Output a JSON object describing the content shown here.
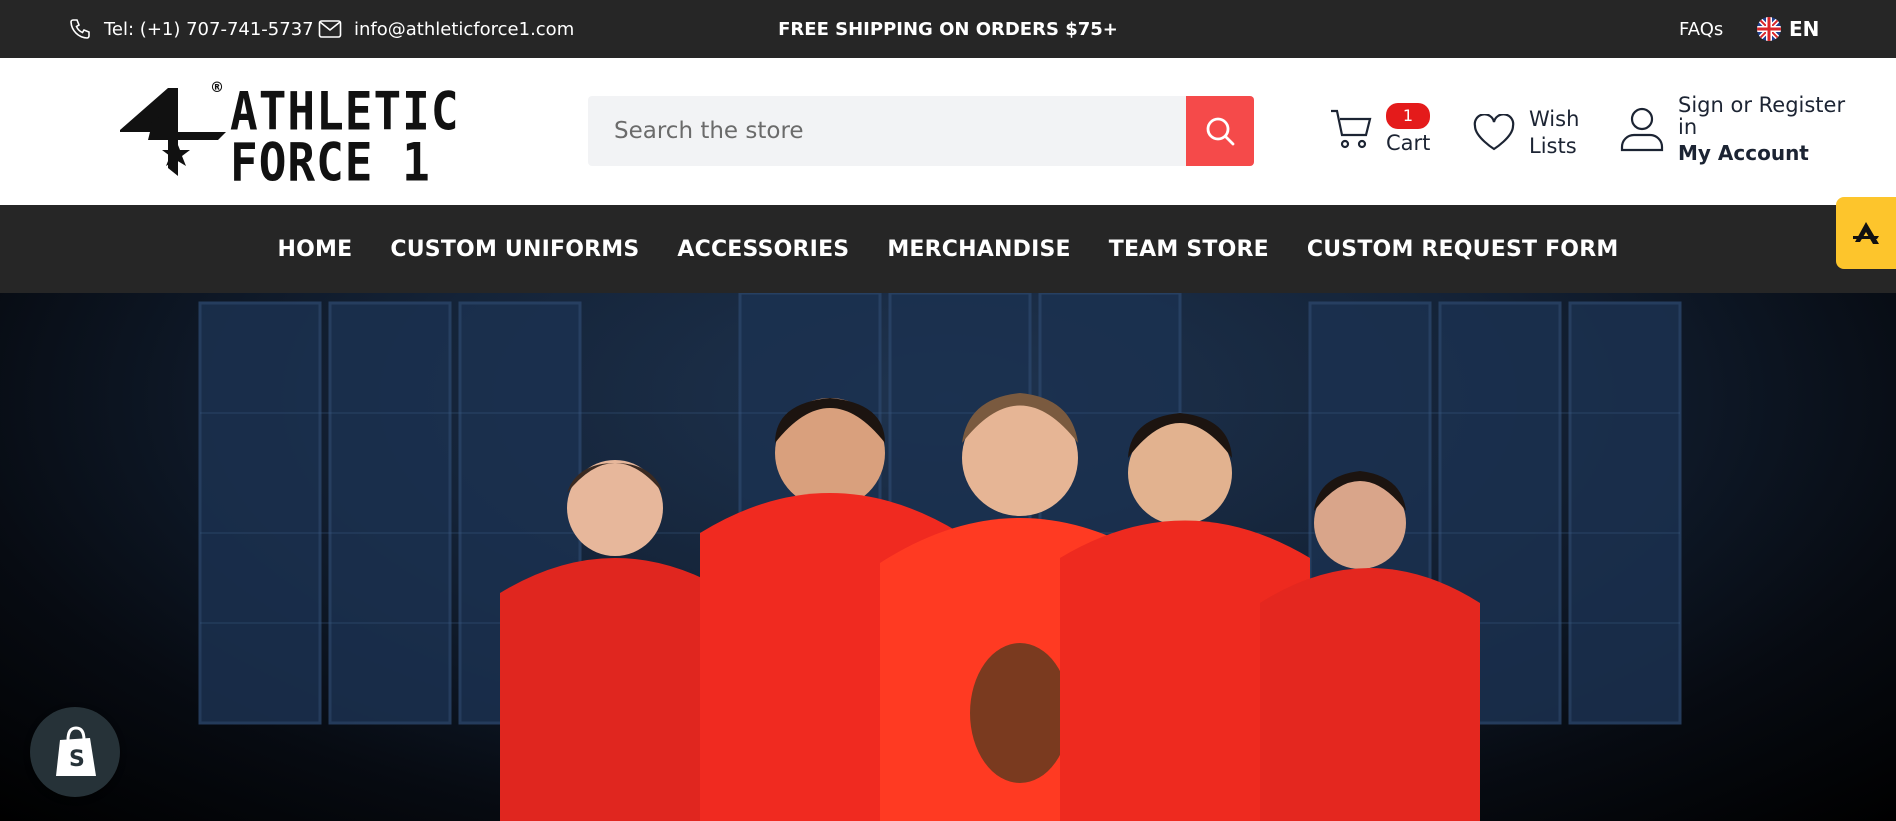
{
  "topbar": {
    "phone": "Tel: (+1) 707-741-5737",
    "email": "info@athleticforce1.com",
    "promo": "FREE SHIPPING ON ORDERS $75+",
    "faqs": "FAQs",
    "language": "EN"
  },
  "header": {
    "logo_line1": "ATHLETIC",
    "logo_line2": "FORCE 1",
    "logo_reg": "®",
    "search_placeholder": "Search the store",
    "cart_count": "1",
    "cart_label": "Cart",
    "wish_line1": "Wish",
    "wish_line2": "Lists",
    "account_line1": "Sign or Register",
    "account_line2": "in",
    "account_label": "My Account"
  },
  "nav": {
    "items": [
      "HOME",
      "CUSTOM UNIFORMS",
      "ACCESSORIES",
      "MERCHANDISE",
      "TEAM STORE",
      "CUSTOM REQUEST FORM"
    ]
  },
  "colors": {
    "topbar_bg": "#262626",
    "accent_red": "#f54a4a",
    "badge_red": "#e41b1b",
    "floating_yellow": "#fdc52c"
  },
  "icons": {
    "phone": "phone-icon",
    "mail": "mail-icon",
    "flag": "uk-flag-icon",
    "search": "search-icon",
    "cart": "cart-icon",
    "heart": "heart-icon",
    "user": "user-icon",
    "shopify": "shopify-bag-icon"
  }
}
